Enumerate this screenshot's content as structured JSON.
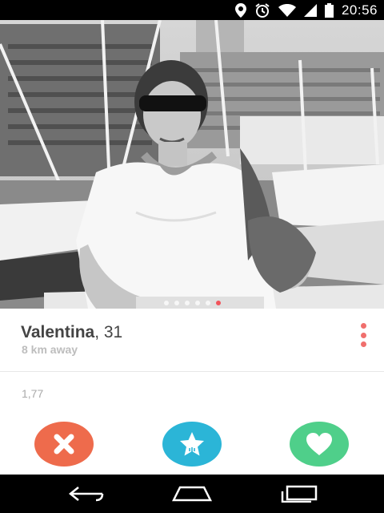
{
  "status_bar": {
    "time": "20:56",
    "icons": [
      "location-icon",
      "alarm-icon",
      "wifi-icon",
      "signal-icon",
      "battery-icon"
    ]
  },
  "profile": {
    "name": "Valentina",
    "age": ", 31",
    "distance": "8 km away",
    "extra_info": "1,77",
    "photo_count": 6,
    "active_photo_index": 5
  },
  "actions": [
    {
      "name": "nope-button",
      "icon": "close-icon",
      "color": "#ee6b4c"
    },
    {
      "name": "super-like-button",
      "icon": "star-icon",
      "color": "#2bb5d7"
    },
    {
      "name": "like-button",
      "icon": "heart-icon",
      "color": "#4fcf8a"
    }
  ],
  "nav_bar": {
    "buttons": [
      "back-icon",
      "home-icon",
      "recent-apps-icon"
    ]
  },
  "colors": {
    "accent": "#f06f6d",
    "nope": "#ee6b4c",
    "super_like": "#2bb5d7",
    "like": "#4fcf8a"
  }
}
